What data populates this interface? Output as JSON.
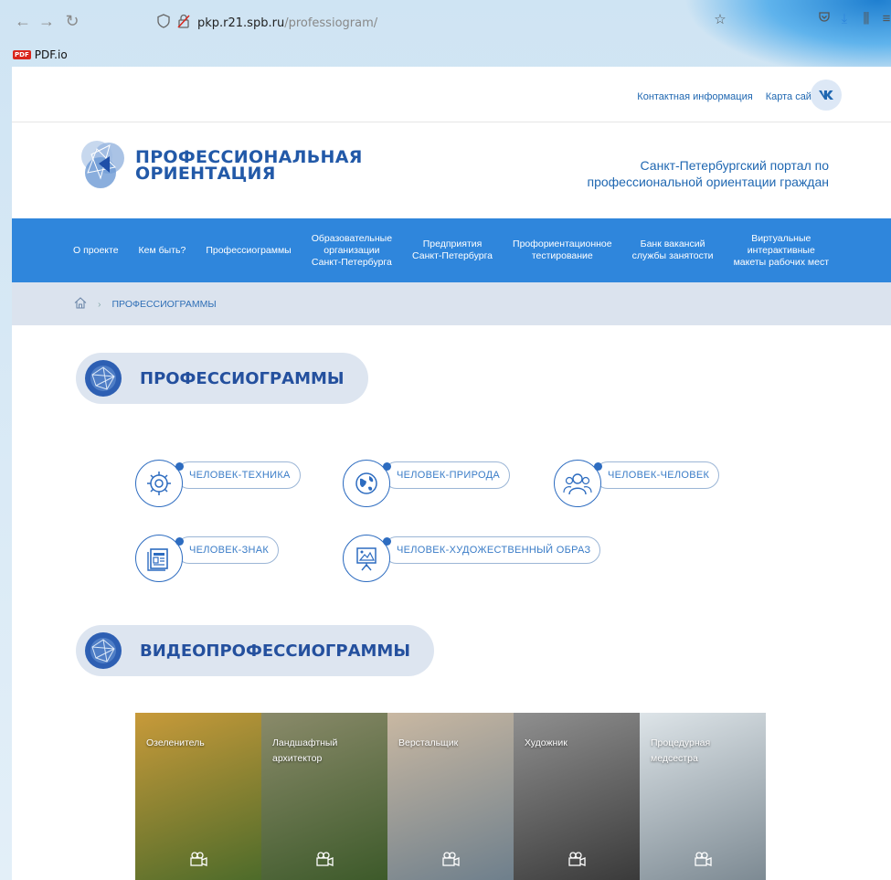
{
  "browser": {
    "url_host": "pkp.r21.spb.ru",
    "url_path": "/professiogram/",
    "bookmark_label": "PDF.io",
    "bookmark_badge": "PDF"
  },
  "top_links": [
    "Контактная информация",
    "Карта сайта"
  ],
  "vk_label": "ВК",
  "logo": {
    "line1": "ПРОФЕССИОНАЛЬНАЯ",
    "line2": "ОРИЕНТАЦИЯ"
  },
  "portal_title": {
    "line1": "Санкт-Петербургский портал по",
    "line2": "профессиональной ориентации граждан"
  },
  "menu": [
    {
      "line1": "О проекте",
      "line2": "",
      "line3": ""
    },
    {
      "line1": "Кем быть?",
      "line2": "",
      "line3": ""
    },
    {
      "line1": "Профессиограммы",
      "line2": "",
      "line3": ""
    },
    {
      "line1": "Образовательные",
      "line2": "организации",
      "line3": "Санкт-Петербурга"
    },
    {
      "line1": "Предприятия",
      "line2": "Санкт-Петербурга",
      "line3": ""
    },
    {
      "line1": "Профориентационное",
      "line2": "тестирование",
      "line3": ""
    },
    {
      "line1": "Банк вакансий",
      "line2": "службы занятости",
      "line3": ""
    },
    {
      "line1": "Виртуальные",
      "line2": "интерактивные",
      "line3": "макеты рабочих мест"
    }
  ],
  "breadcrumb": {
    "current": "ПРОФЕССИОГРАММЫ"
  },
  "sections": {
    "professiograms": "ПРОФЕССИОГРАММЫ",
    "videos": "ВИДЕОПРОФЕССИОГРАММЫ"
  },
  "categories": [
    {
      "label": "ЧЕЛОВЕК-ТЕХНИКА",
      "icon": "gear-icon"
    },
    {
      "label": "ЧЕЛОВЕК-ПРИРОДА",
      "icon": "globe-icon"
    },
    {
      "label": "ЧЕЛОВЕК-ЧЕЛОВЕК",
      "icon": "people-icon"
    },
    {
      "label": "ЧЕЛОВЕК-ЗНАК",
      "icon": "document-icon"
    },
    {
      "label": "ЧЕЛОВЕК-ХУДОЖЕСТВЕННЫЙ ОБРАЗ",
      "icon": "easel-icon"
    }
  ],
  "videos": [
    {
      "line1": "Озеленитель",
      "line2": "",
      "bg1": "#4d6b2a",
      "bg2": "#c89a3a"
    },
    {
      "line1": "Ландшафтный",
      "line2": "архитектор",
      "bg1": "#3d5a2a",
      "bg2": "#8a8a6a"
    },
    {
      "line1": "Верстальщик",
      "line2": "",
      "bg1": "#6e7f8c",
      "bg2": "#c9b8a2"
    },
    {
      "line1": "Художник",
      "line2": "",
      "bg1": "#3a3a3a",
      "bg2": "#8f8f8f"
    },
    {
      "line1": "Процедурная",
      "line2": "медсестра",
      "bg1": "#7d8a93",
      "bg2": "#dde4e8"
    }
  ]
}
